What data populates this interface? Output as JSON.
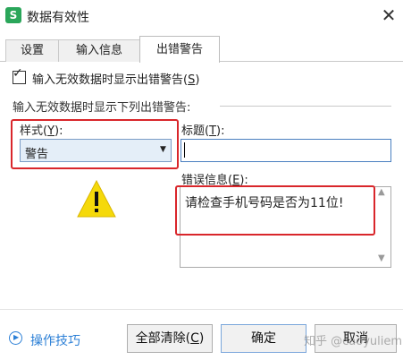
{
  "window": {
    "app_icon_letter": "S",
    "title": "数据有效性",
    "close_symbol": "✕"
  },
  "tabs": [
    {
      "label": "设置",
      "active": false
    },
    {
      "label": "输入信息",
      "active": false
    },
    {
      "label": "出错警告",
      "active": true
    }
  ],
  "show_error_checkbox": {
    "checked": true,
    "label": "输入无效数据时显示出错警告",
    "hotkey": "S"
  },
  "section_label": "输入无效数据时显示下列出错警告:",
  "style": {
    "label": "样式",
    "hotkey": "Y",
    "value": "警告"
  },
  "title_field": {
    "label": "标题",
    "hotkey": "T",
    "value": ""
  },
  "error_message": {
    "label": "错误信息",
    "hotkey": "E",
    "value": "请检查手机号码是否为11位!"
  },
  "footer": {
    "tips_link": "操作技巧",
    "clear_all": {
      "label": "全部清除",
      "hotkey": "C"
    },
    "ok": "确定",
    "cancel": "取消"
  },
  "watermark": "知乎 @caoyuliem",
  "colors": {
    "highlight_box": "#d9262b",
    "link": "#2b7fd6",
    "warning": "#f5d90a"
  }
}
